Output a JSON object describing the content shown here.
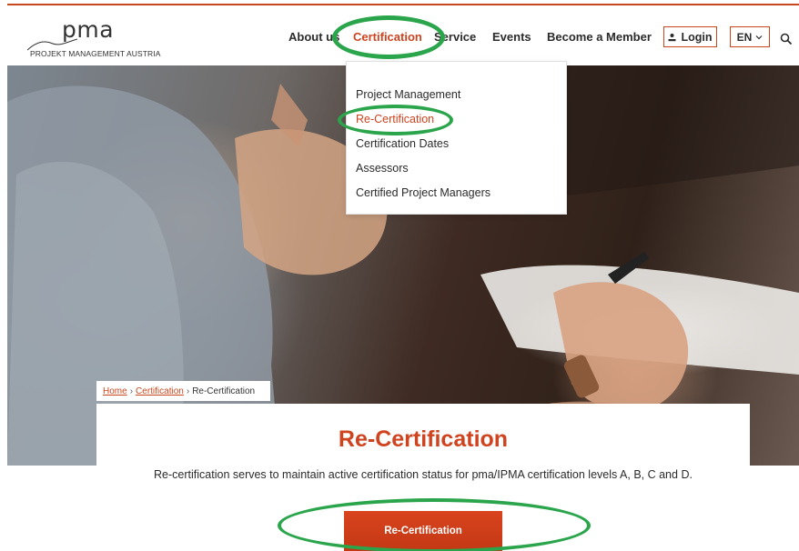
{
  "logo": {
    "wordmark": "pma",
    "subtitle": "PROJEKT MANAGEMENT AUSTRIA"
  },
  "nav": {
    "items": [
      {
        "label": "About us"
      },
      {
        "label": "Certification"
      },
      {
        "label": "Service"
      },
      {
        "label": "Events"
      },
      {
        "label": "Become a Member"
      }
    ],
    "active": "Certification",
    "login_label": "Login",
    "language": "EN",
    "search_icon": "search-icon",
    "accent_color": "#d0431f"
  },
  "dropdown": {
    "items": [
      {
        "label": "Project Management"
      },
      {
        "label": "Re-Certification"
      },
      {
        "label": "Certification Dates"
      },
      {
        "label": "Assessors"
      },
      {
        "label": "Certified Project Managers"
      }
    ],
    "active": "Re-Certification"
  },
  "breadcrumb": {
    "home": "Home",
    "separator": "›",
    "parent": "Certification",
    "current": "Re-Certification"
  },
  "content": {
    "title": "Re-Certification",
    "description": "Re-certification serves to maintain active certification status for pma/IPMA certification levels A, B, C and D.",
    "button_label": "Re-Certification"
  },
  "annotations": {
    "highlight_color": "#2aa54b"
  }
}
